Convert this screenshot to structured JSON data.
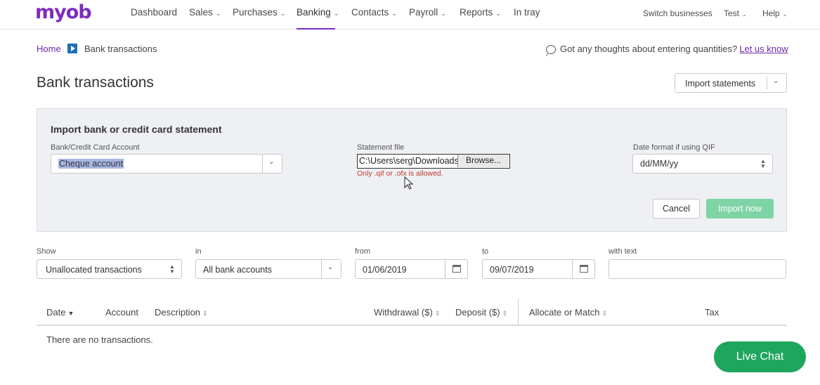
{
  "brand": {
    "logo_text": "myob",
    "accent": "#7d2bbf",
    "link_color": "#6a2aa6"
  },
  "nav": {
    "items": [
      {
        "label": "Dashboard"
      },
      {
        "label": "Sales"
      },
      {
        "label": "Purchases"
      },
      {
        "label": "Banking"
      },
      {
        "label": "Contacts"
      },
      {
        "label": "Payroll"
      },
      {
        "label": "Reports"
      },
      {
        "label": "In tray"
      }
    ],
    "active": "Banking",
    "right": [
      {
        "label": "Switch businesses"
      },
      {
        "label": "Test"
      },
      {
        "label": "Help"
      }
    ]
  },
  "breadcrumb": {
    "home": "Home",
    "current": "Bank transactions"
  },
  "feedback": {
    "text": "Got any thoughts about entering quantities?",
    "link": "Let us know"
  },
  "page": {
    "title": "Bank transactions",
    "import_button": "Import statements"
  },
  "import_panel": {
    "title": "Import bank or credit card statement",
    "account_label": "Bank/Credit Card Account",
    "account_value": "Cheque account",
    "file_label": "Statement file",
    "file_path": "C:\\Users\\serg\\Downloads",
    "browse_label": "Browse...",
    "file_error": "Only .qif or .ofx is allowed.",
    "date_format_label": "Date format if using QIF",
    "date_format_value": "dd/MM/yy",
    "cancel_label": "Cancel",
    "import_label": "Import now",
    "import_color": "#7fd4a5"
  },
  "filters": {
    "show_label": "Show",
    "show_value": "Unallocated transactions",
    "in_label": "in",
    "in_value": "All bank accounts",
    "from_label": "from",
    "from_value": "01/06/2019",
    "to_label": "to",
    "to_value": "09/07/2019",
    "text_label": "with text",
    "text_value": ""
  },
  "table": {
    "columns": [
      {
        "label": "Date"
      },
      {
        "label": "Account"
      },
      {
        "label": "Description"
      },
      {
        "label": "Withdrawal ($)"
      },
      {
        "label": "Deposit ($)"
      },
      {
        "label": "Allocate or Match"
      },
      {
        "label": "Tax"
      }
    ],
    "empty_message": "There are no transactions."
  },
  "chat": {
    "label": "Live Chat",
    "color": "#1fa65e"
  }
}
